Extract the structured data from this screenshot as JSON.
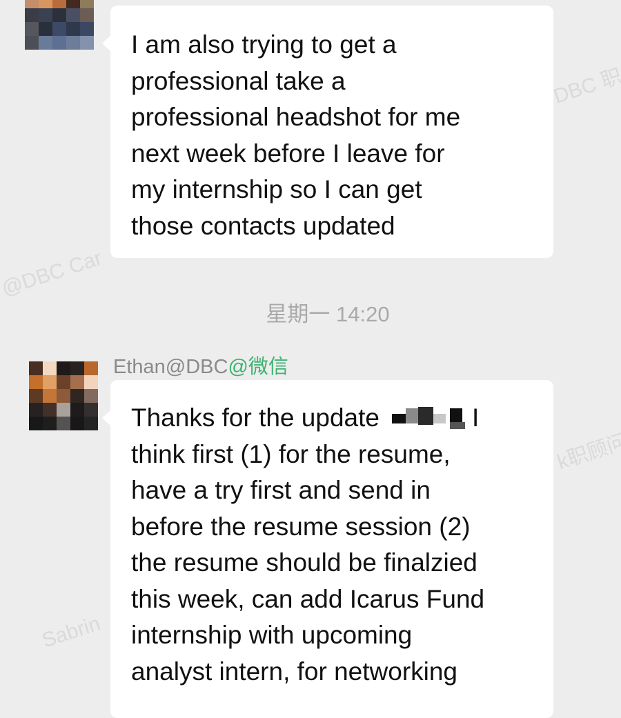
{
  "watermarks": [
    "DBC 职",
    "@DBC Car",
    "k职顾问",
    "Sabrin"
  ],
  "messages": [
    {
      "lines": [
        "I am also trying to get a",
        "professional take a",
        "professional headshot for me",
        "next week before I leave for",
        "my internship so I can get",
        "those contacts updated"
      ]
    },
    {
      "timestamp": "星期一 14:20",
      "sender": {
        "name": "Ethan@DBC",
        "suffix": "@微信"
      },
      "first_line_before": "Thanks for the update",
      "first_line_after": "I",
      "lines": [
        "think first (1) for the resume,",
        "have a try first and send in",
        "before the resume session (2)",
        "the resume should be finalzied",
        "this week, can add Icarus Fund",
        "internship with upcoming",
        "analyst intern, for networking"
      ]
    }
  ]
}
